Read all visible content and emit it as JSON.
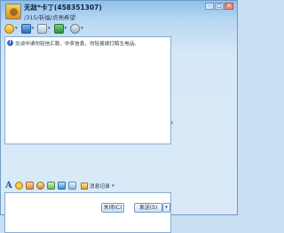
{
  "contact": {
    "name": "无敌*卡丁(458351307)",
    "signature": "/315/祈福/点亮希望"
  },
  "window_buttons": {
    "minimize": "-",
    "maximize": "□",
    "close": "×"
  },
  "toolbar": {
    "items": [
      {
        "icon": "video-call-icon"
      },
      {
        "icon": "voice-call-icon"
      },
      {
        "icon": "send-file-icon"
      },
      {
        "icon": "remote-assist-icon"
      },
      {
        "icon": "app-settings-icon"
      }
    ],
    "caret": "▾"
  },
  "chat": {
    "notice_icon": "i",
    "notice": "交谈中请勿轻信汇款、中奖信息，勿轻易拨打陌生电话。"
  },
  "collapse_arrow": "‹",
  "format_bar": {
    "font_glyph": "A",
    "history_label": "消息记录",
    "caret": "▾"
  },
  "buttons": {
    "close": "关闭(C)",
    "send": "发送(S)",
    "send_options": "▾"
  }
}
